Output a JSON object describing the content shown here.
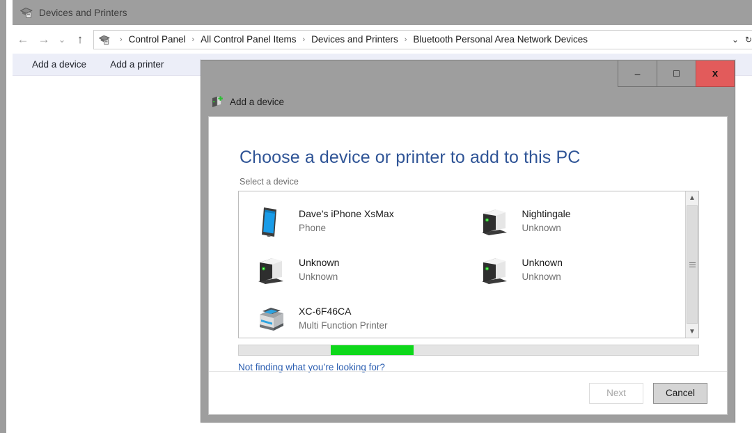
{
  "window": {
    "title": "Devices and Printers",
    "icon": "devices-and-printers-icon"
  },
  "navigation": {
    "back_icon": "back-arrow-icon",
    "forward_icon": "forward-arrow-icon",
    "history_icon": "chevron-down-icon",
    "up_icon": "up-arrow-icon",
    "address_icon": "devices-and-printers-icon",
    "breadcrumbs": [
      "Control Panel",
      "All Control Panel Items",
      "Devices and Printers",
      "Bluetooth Personal Area Network Devices"
    ],
    "separator": "›",
    "dropdown_icon": "chevron-down-icon",
    "refresh_icon": "refresh-icon"
  },
  "command_bar": {
    "items": [
      {
        "label": "Add a device",
        "name": "add-a-device"
      },
      {
        "label": "Add a printer",
        "name": "add-a-printer"
      }
    ]
  },
  "dialog": {
    "app_title": "Add a device",
    "app_icon": "add-device-icon",
    "window_controls": {
      "minimize": "–",
      "maximize": "☐",
      "close": "x"
    },
    "heading": "Choose a device or printer to add to this PC",
    "subheading": "Select a device",
    "devices": [
      {
        "name": "Dave’s iPhone XsMax",
        "type": "Phone",
        "icon": "phone-icon"
      },
      {
        "name": "Nightingale",
        "type": "Unknown",
        "icon": "computer-icon"
      },
      {
        "name": "Unknown",
        "type": "Unknown",
        "icon": "computer-icon"
      },
      {
        "name": "Unknown",
        "type": "Unknown",
        "icon": "computer-icon"
      },
      {
        "name": "XC-6F46CA",
        "type": "Multi Function Printer",
        "icon": "printer-icon"
      }
    ],
    "scrollbar": {
      "up_icon": "chevron-up-icon",
      "down_icon": "chevron-down-icon"
    },
    "progress": {
      "color": "#0ed81b",
      "mode": "marquee",
      "position_pct": 20,
      "chunk_width_pct": 18
    },
    "help_link": "Not finding what you’re looking for?",
    "buttons": {
      "next": {
        "label": "Next",
        "enabled": false
      },
      "cancel": {
        "label": "Cancel",
        "enabled": true
      }
    }
  },
  "colors": {
    "title_bar": "#9e9e9e",
    "command_bar": "#eceef8",
    "heading_blue": "#2f5496",
    "link_blue": "#2a5db0",
    "close_red": "#e25b5b",
    "progress_green": "#0ed81b"
  }
}
